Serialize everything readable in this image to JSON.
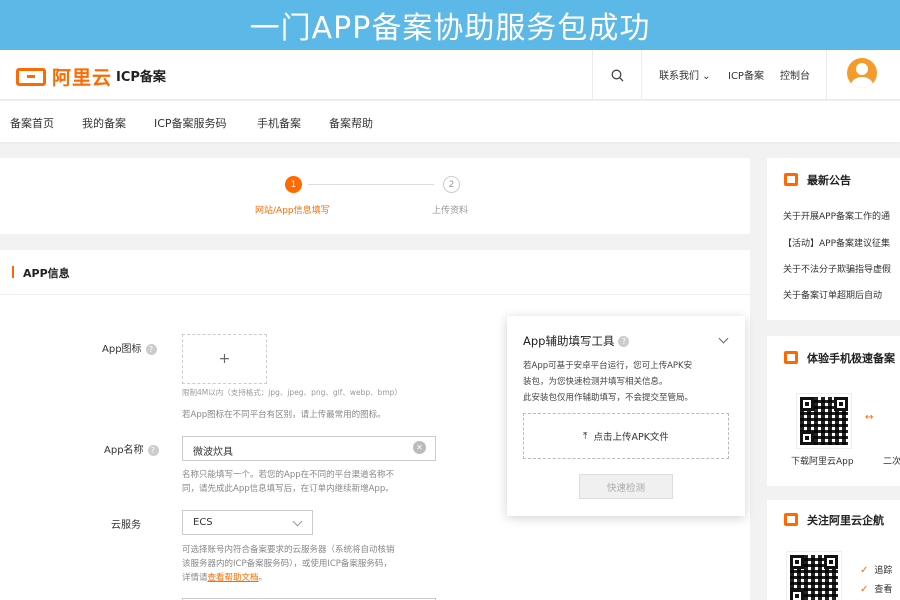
{
  "banner": {
    "title": "一门APP备案协助服务包成功"
  },
  "header": {
    "logo_text": "阿里云",
    "product": "ICP备案",
    "contact": "联系我们",
    "icp": "ICP备案",
    "console": "控制台"
  },
  "nav": {
    "items": [
      "备案首页",
      "我的备案",
      "ICP备案服务码",
      "手机备案",
      "备案帮助"
    ]
  },
  "steps": [
    {
      "num": "1",
      "label": "网站/App信息填写",
      "active": true
    },
    {
      "num": "2",
      "label": "上传资料",
      "active": false
    }
  ],
  "form": {
    "section_title": "APP信息",
    "icon_label": "App图标",
    "upload_plus": "+",
    "icon_hint_small": "限制4M以内（支持格式：jpg、jpeg、png、gif、webp、bmp）",
    "icon_hint": "若App图标在不同平台有区别，请上传最常用的图标。",
    "name_label": "App名称",
    "name_value": "微波炊具",
    "name_hint_1": "名称只能填写一个。若您的App在不同的平台渠道名称不",
    "name_hint_2": "同，请先成此App信息填写后，在订单内继续新增App。",
    "cloud_label": "云服务",
    "cloud_value": "ECS",
    "cloud_hint_1": "可选择账号内符合备案要求的云服务器（系统将自动核销",
    "cloud_hint_2": "该服务器内的ICP备案服务码），或使用ICP备案服务码，",
    "cloud_hint_3": "详情请",
    "cloud_hint_link": "查看帮助文档",
    "cloud_hint_end": "。"
  },
  "assist": {
    "title": "App辅助填写工具",
    "desc_1": "若App可基于安卓平台运行，您可上传APK安",
    "desc_2": "装包，为您快速检测并填写相关信息。",
    "desc_3": "此安装包仅用作辅助填写，不会提交至管局。",
    "upload_label": "点击上传APK文件",
    "check_button": "快速检测"
  },
  "sidebar": {
    "notice_title": "最新公告",
    "notices": [
      "关于开展APP备案工作的通",
      "【活动】APP备案建议征集",
      "关于不法分子欺骗指导虚假",
      "关于备案订单超期后自动"
    ],
    "app_title": "体验手机极速备案",
    "qr_caption_1": "下载阿里云App",
    "qr_caption_2": "二次",
    "follow_title": "关注阿里云企航",
    "follow_items": [
      "追踪",
      "查看"
    ]
  },
  "colors": {
    "accent": "#ff6a00",
    "banner": "#5cb8e6"
  }
}
